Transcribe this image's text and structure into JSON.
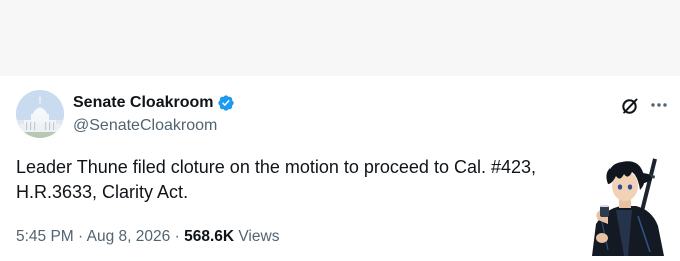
{
  "account": {
    "display_name": "Senate Cloakroom",
    "handle": "@SenateCloakroom",
    "verified": true
  },
  "post": {
    "text_line1": "Leader Thune filed cloture on the motion to proceed to Cal. #423,",
    "text_line2": "H.R.3633, Clarity Act.",
    "time": "5:45 PM",
    "separator": "·",
    "date": "Aug 8, 2026",
    "views_count": "568.6K",
    "views_label": "Views"
  },
  "icons": {
    "avatar": "capitol-avatar",
    "verified": "verified-badge-icon",
    "grok": "grok-icon",
    "more": "more-icon",
    "sticker": "anime-character-sticker"
  },
  "colors": {
    "primary_text": "#0f1419",
    "secondary_text": "#536471",
    "verified_blue": "#1d9bf0",
    "top_band": "#f7f7f7"
  }
}
